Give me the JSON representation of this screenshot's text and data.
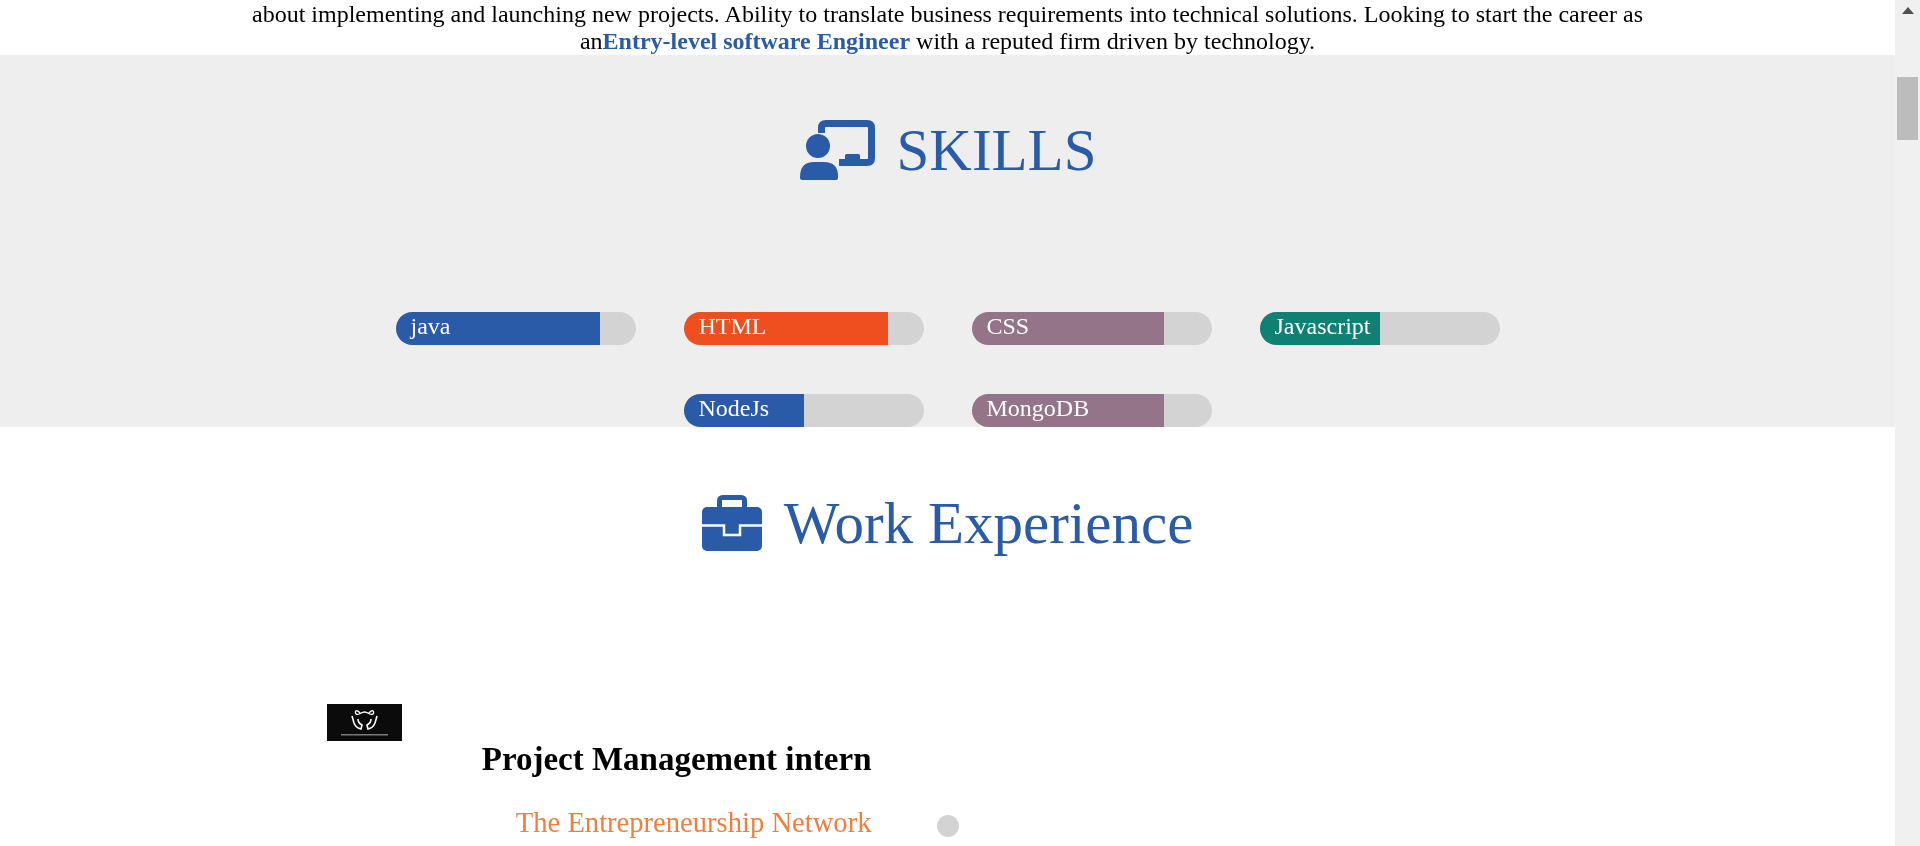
{
  "intro": {
    "text": "about implementing and launching new projects. Ability to translate business requirements into technical solutions. Looking to start the career as an**Entry-level software Engineer** with a reputed firm driven by technology."
  },
  "skills": {
    "title": "SKILLS",
    "items": [
      {
        "name": "java",
        "level": 0.85,
        "color": "#2a5ba8"
      },
      {
        "name": "HTML",
        "level": 0.85,
        "color": "#ef4f1f"
      },
      {
        "name": "CSS",
        "level": 0.8,
        "color": "#947489"
      },
      {
        "name": "Javascript",
        "level": 0.5,
        "color": "#0e8074"
      },
      {
        "name": "NodeJs",
        "level": 0.5,
        "color": "#2a5ba8"
      },
      {
        "name": "MongoDB",
        "level": 0.8,
        "color": "#947489"
      }
    ]
  },
  "work_experience": {
    "title": "Work Experience",
    "jobs": [
      {
        "title": "Project Management intern",
        "company": "The Entrepreneurship Network"
      }
    ]
  }
}
